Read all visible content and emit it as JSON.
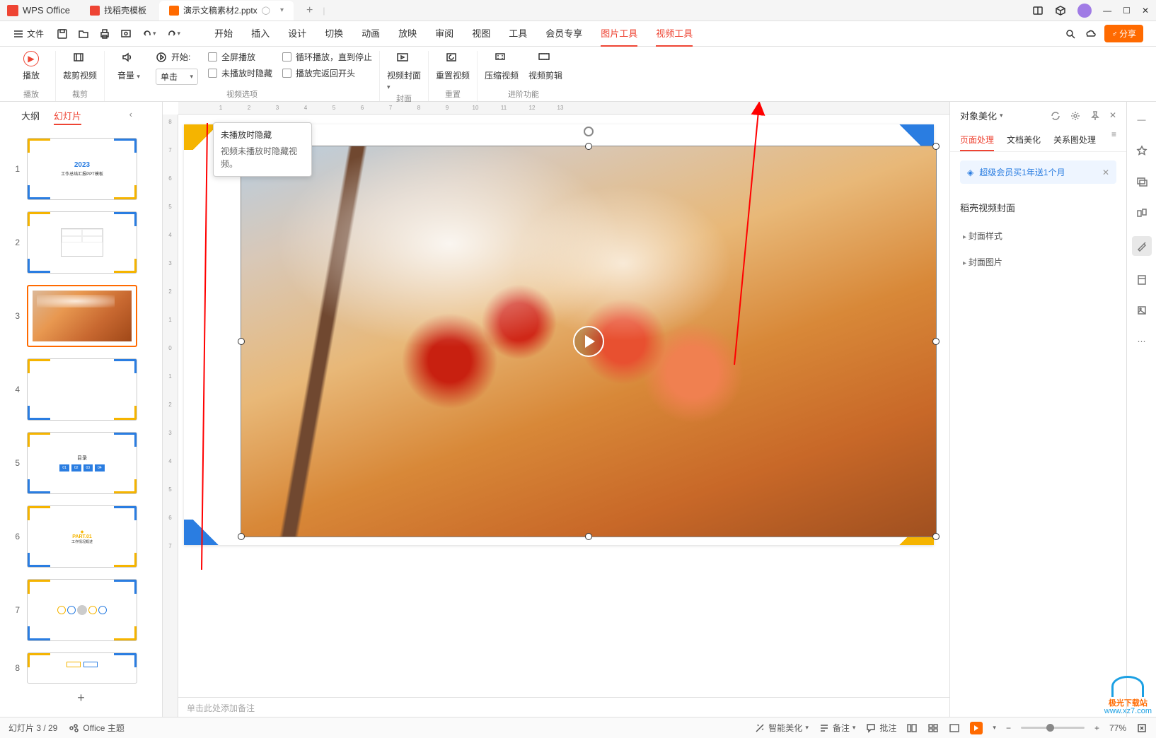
{
  "app_name": "WPS Office",
  "tabs": [
    {
      "label": "找稻壳模板",
      "icon_color": "#e43"
    },
    {
      "label": "演示文稿素材2.pptx",
      "icon_color": "#e85",
      "active": true
    }
  ],
  "menu": {
    "file": "文件",
    "items": [
      "开始",
      "插入",
      "设计",
      "切换",
      "动画",
      "放映",
      "审阅",
      "视图",
      "工具",
      "会员专享",
      "图片工具",
      "视频工具"
    ],
    "active": [
      "图片工具",
      "视频工具"
    ]
  },
  "share_btn": "分享",
  "ribbon": {
    "play": "播放",
    "play_group": "播放",
    "crop": "裁剪视频",
    "crop_group": "裁剪",
    "volume": "音量",
    "start": "开始:",
    "start_value": "单击",
    "fullscreen": "全屏播放",
    "hide_not_playing": "未播放时隐藏",
    "loop": "循环播放，直到停止",
    "rewind": "播放完返回开头",
    "video_options": "视频选项",
    "cover": "视频封面",
    "cover_group": "封面",
    "reset": "重置视频",
    "reset_group": "重置",
    "compress": "压缩视频",
    "trim": "视频剪辑",
    "advanced_group": "进阶功能"
  },
  "tooltip": {
    "title": "未播放时隐藏",
    "body": "视频未播放时隐藏视频。"
  },
  "left_panel": {
    "tabs": [
      "大纲",
      "幻灯片"
    ],
    "active": "幻灯片"
  },
  "thumbnails": [
    {
      "n": 1,
      "title": "2023",
      "subtitle": "工作总结汇报PPT模板"
    },
    {
      "n": 2,
      "diagram": true
    },
    {
      "n": 3,
      "image": true,
      "selected": true
    },
    {
      "n": 4,
      "blank": true
    },
    {
      "n": 5,
      "toc": true,
      "title": "目录",
      "boxes": [
        "01",
        "02",
        "03",
        "04"
      ]
    },
    {
      "n": 6,
      "part": "PART.01",
      "sub": "工作情况概述"
    },
    {
      "n": 7,
      "flow": true
    },
    {
      "n": 8,
      "partial": true
    }
  ],
  "ruler_h": [
    "",
    "1",
    "2",
    "3",
    "4",
    "5",
    "6",
    "7",
    "8",
    "9",
    "10",
    "11",
    "12",
    "13",
    "12",
    "11",
    "10",
    "9",
    "8",
    "7",
    "6",
    "5",
    "4",
    "3",
    "2",
    "1",
    "",
    "1",
    "2",
    "3",
    "4",
    "5",
    "6",
    "7",
    "8",
    "9",
    "10",
    "11",
    "12",
    "13"
  ],
  "ruler_v": [
    "8",
    "7",
    "6",
    "5",
    "4",
    "3",
    "2",
    "1",
    "0",
    "1",
    "2",
    "3",
    "4",
    "5",
    "6",
    "7"
  ],
  "notes_placeholder": "单击此处添加备注",
  "right_panel": {
    "title": "对象美化",
    "tabs": [
      "页面处理",
      "文档美化",
      "关系图处理"
    ],
    "active": "页面处理",
    "promo": "超级会员买1年送1个月",
    "section": "稻壳视频封面",
    "items": [
      "封面样式",
      "封面图片"
    ]
  },
  "statusbar": {
    "slide_info": "幻灯片 3 / 29",
    "theme": "Office 主题",
    "smart_beautify": "智能美化",
    "notes": "备注",
    "comments": "批注",
    "zoom": "77%"
  },
  "watermark": {
    "brand": "极光下载站",
    "url": "www.xz7.com"
  }
}
